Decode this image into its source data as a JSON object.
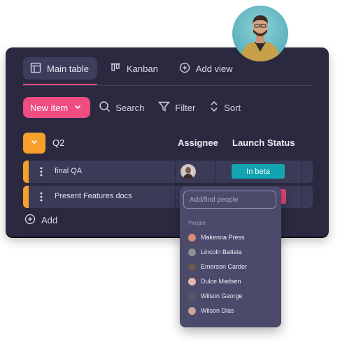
{
  "views": [
    {
      "label": "Main table",
      "icon": "table-icon",
      "active": true
    },
    {
      "label": "Kanban",
      "icon": "kanban-icon",
      "active": false
    },
    {
      "label": "Add view",
      "icon": "plus-circle-icon",
      "active": false
    }
  ],
  "toolbar": {
    "new_item": "New item",
    "search": "Search",
    "filter": "Filter",
    "sort": "Sort"
  },
  "group": {
    "name": "Q2",
    "color": "#f6a02a",
    "columns": {
      "assignee": "Assignee",
      "status": "Launch Status"
    }
  },
  "rows": [
    {
      "name": "final QA",
      "status": "In beta",
      "status_color": "#14a3b1"
    },
    {
      "name": "Present Features docs",
      "status": "",
      "status_color": "#e0436e"
    }
  ],
  "add_row": "Add",
  "people_picker": {
    "placeholder": "Add/find people",
    "section": "People",
    "people": [
      {
        "name": "Makenna Press",
        "color": "#d98b7a"
      },
      {
        "name": "Lincoln Batista",
        "color": "#8a8f99"
      },
      {
        "name": "Emerson Carder",
        "color": "#6b5b4e"
      },
      {
        "name": "Dulce Madsen",
        "color": "#e2b8b0"
      },
      {
        "name": "Wilson George",
        "color": "#5a5a66"
      },
      {
        "name": "Wilson Dias",
        "color": "#c9a49a"
      }
    ]
  },
  "colors": {
    "accent": "#ee4d82",
    "panel": "#2a2940",
    "row": "#3b3a57"
  }
}
